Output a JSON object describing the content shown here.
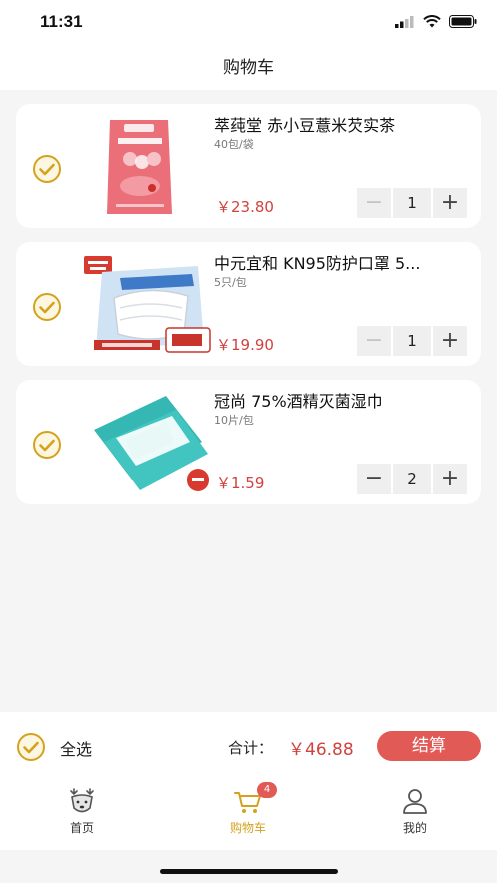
{
  "status_bar": {
    "time": "11:31"
  },
  "header": {
    "title": "购物车"
  },
  "cart": {
    "items": [
      {
        "name": "萃莼堂 赤小豆薏米芡实茶",
        "spec": "40包/袋",
        "price": "￥23.80",
        "quantity": "1",
        "selected": true,
        "image": "red-tea-bag-product"
      },
      {
        "name": "中元宜和 KN95防护口罩 5...",
        "spec": "5只/包",
        "price": "￥19.90",
        "quantity": "1",
        "selected": true,
        "image": "kn95-mask-pack-product"
      },
      {
        "name": "冠尚 75%酒精灭菌湿巾",
        "spec": "10片/包",
        "price": "￥1.59",
        "quantity": "2",
        "selected": true,
        "image": "alcohol-wipes-product"
      }
    ],
    "minus_label": "−",
    "plus_label": "+"
  },
  "checkout": {
    "select_all_label": "全选",
    "total_label": "合计：",
    "total_value": "￥46.88",
    "checkout_button": "结算"
  },
  "tab_bar": {
    "tabs": [
      {
        "label": "首页",
        "icon": "deer-home-icon",
        "active": false
      },
      {
        "label": "购物车",
        "icon": "cart-icon",
        "active": true,
        "badge": "4"
      },
      {
        "label": "我的",
        "icon": "user-icon",
        "active": false
      }
    ]
  },
  "colors": {
    "accent": "#e25a55",
    "price": "#d0423e",
    "check": "#d4a21e"
  }
}
